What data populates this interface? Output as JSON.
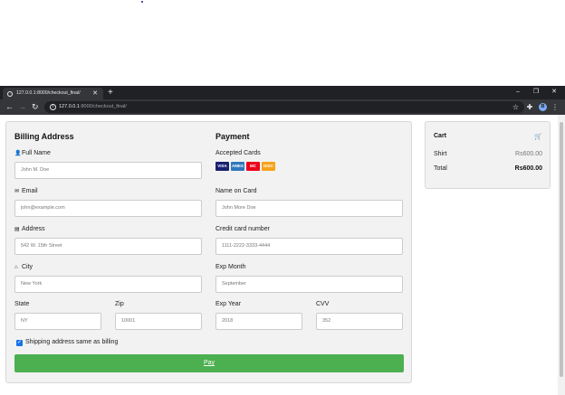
{
  "browser": {
    "tab_title": "127.0.0.1:8000/checkout_final/",
    "url_host": "127.0.0.1",
    "url_rest": ":8000/checkout_final/",
    "profile_initial": "B"
  },
  "billing": {
    "heading": "Billing Address",
    "full_name": {
      "label": "Full Name",
      "placeholder": "John M. Doe"
    },
    "email": {
      "label": "Email",
      "placeholder": "john@example.com"
    },
    "address": {
      "label": "Address",
      "placeholder": "542 W. 15th Street"
    },
    "city": {
      "label": "City",
      "placeholder": "New York"
    },
    "state": {
      "label": "State",
      "placeholder": "NY"
    },
    "zip": {
      "label": "Zip",
      "placeholder": "10001"
    }
  },
  "payment": {
    "heading": "Payment",
    "accepted_label": "Accepted Cards",
    "cards": [
      "VISA",
      "AMEX",
      "MC",
      "DISC"
    ],
    "name_on_card": {
      "label": "Name on Card",
      "placeholder": "John More Doe"
    },
    "card_number": {
      "label": "Credit card number",
      "placeholder": "1111-2222-3333-4444"
    },
    "exp_month": {
      "label": "Exp Month",
      "placeholder": "September"
    },
    "exp_year": {
      "label": "Exp Year",
      "placeholder": "2018"
    },
    "cvv": {
      "label": "CVV",
      "placeholder": "352"
    }
  },
  "shipping_same": {
    "label": "Shipping address same as billing",
    "checked": true
  },
  "pay_button": "Pay",
  "cart": {
    "heading": "Cart",
    "items": [
      {
        "name": "Shirt",
        "price": "Rs600.00"
      }
    ],
    "total_label": "Total",
    "total_value": "Rs600.00"
  },
  "colors": {
    "accent": "#4caf50",
    "panel": "#f2f2f2",
    "browser_dark": "#202124"
  }
}
